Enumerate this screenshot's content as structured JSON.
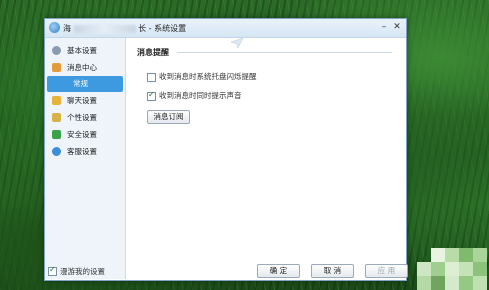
{
  "window": {
    "title_prefix": "海",
    "title_suffix": "长 - 系统设置"
  },
  "sidebar": {
    "items": [
      {
        "label": "基本设置",
        "icon": "gear-icon",
        "color": "#8a9bb0"
      },
      {
        "label": "消息中心",
        "icon": "envelope-icon",
        "color": "#e29a3a"
      },
      {
        "label": "常规",
        "selected": true
      },
      {
        "label": "聊天设置",
        "icon": "chat-icon",
        "color": "#e6b33a"
      },
      {
        "label": "个性设置",
        "icon": "person-icon",
        "color": "#d7b24a"
      },
      {
        "label": "安全设置",
        "icon": "shield-icon",
        "color": "#3aa34a"
      },
      {
        "label": "客服设置",
        "icon": "support-icon",
        "color": "#3a8fd6"
      }
    ]
  },
  "content": {
    "section_title": "消息提醒",
    "options": [
      {
        "label": "收到消息时系统托盘闪烁提醒",
        "checked": false
      },
      {
        "label": "收到消息时同时提示声音",
        "checked": true
      }
    ],
    "subscribe_button": "消息订阅"
  },
  "footer": {
    "roam_label": "漫游我的设置",
    "roam_checked": true,
    "ok": "确 定",
    "cancel": "取 消",
    "apply": "应 用"
  },
  "colors": {
    "accent": "#3d9ae0",
    "titlebar": "#dce9f5",
    "sidebar_bg": "#eef4fa"
  }
}
